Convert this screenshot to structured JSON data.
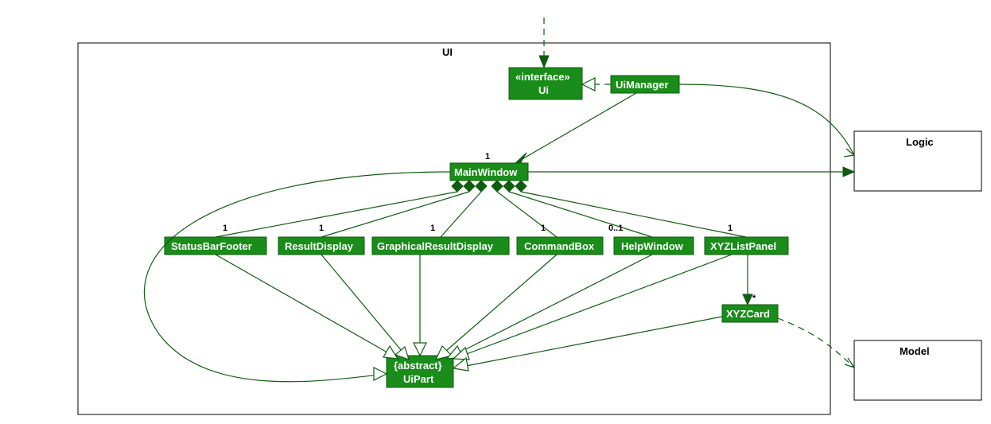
{
  "package": {
    "name": "UI"
  },
  "classes": {
    "ui": {
      "stereo": "«interface»",
      "name": "Ui"
    },
    "uimanager": {
      "name": "UiManager"
    },
    "mainwindow": {
      "name": "MainWindow"
    },
    "statusbarfooter": {
      "name": "StatusBarFooter"
    },
    "resultdisplay": {
      "name": "ResultDisplay"
    },
    "graphicalresultdisplay": {
      "name": "GraphicalResultDisplay"
    },
    "commandbox": {
      "name": "CommandBox"
    },
    "helpwindow": {
      "name": "HelpWindow"
    },
    "xyzlistpanel": {
      "name": "XYZListPanel"
    },
    "xyzcard": {
      "name": "XYZCard"
    },
    "uipart": {
      "stereo": "{abstract}",
      "name": "UiPart"
    }
  },
  "external": {
    "logic": {
      "name": "Logic"
    },
    "model": {
      "name": "Model"
    }
  },
  "mult": {
    "mainwindow": "1",
    "statusbarfooter": "1",
    "resultdisplay": "1",
    "graphicalresultdisplay": "1",
    "commandbox": "1",
    "helpwindow": "0..1",
    "xyzlistpanel": "1",
    "xyzcard": "*"
  },
  "chart_data": {
    "type": "uml_class_diagram",
    "package": "UI",
    "nodes": [
      {
        "id": "Ui",
        "stereo": "interface"
      },
      {
        "id": "UiManager"
      },
      {
        "id": "MainWindow"
      },
      {
        "id": "StatusBarFooter"
      },
      {
        "id": "ResultDisplay"
      },
      {
        "id": "GraphicalResultDisplay"
      },
      {
        "id": "CommandBox"
      },
      {
        "id": "HelpWindow"
      },
      {
        "id": "XYZListPanel"
      },
      {
        "id": "XYZCard"
      },
      {
        "id": "UiPart",
        "stereo": "abstract"
      },
      {
        "id": "Logic",
        "external": true
      },
      {
        "id": "Model",
        "external": true
      }
    ],
    "edges": [
      {
        "from": "outside",
        "to": "Ui",
        "type": "dependency"
      },
      {
        "from": "UiManager",
        "to": "Ui",
        "type": "realization"
      },
      {
        "from": "UiManager",
        "to": "MainWindow",
        "type": "association",
        "mult": "1"
      },
      {
        "from": "UiManager",
        "to": "Logic",
        "type": "association"
      },
      {
        "from": "MainWindow",
        "to": "Logic",
        "type": "association"
      },
      {
        "from": "MainWindow",
        "to": "StatusBarFooter",
        "type": "composition",
        "mult": "1"
      },
      {
        "from": "MainWindow",
        "to": "ResultDisplay",
        "type": "composition",
        "mult": "1"
      },
      {
        "from": "MainWindow",
        "to": "GraphicalResultDisplay",
        "type": "composition",
        "mult": "1"
      },
      {
        "from": "MainWindow",
        "to": "CommandBox",
        "type": "composition",
        "mult": "1"
      },
      {
        "from": "MainWindow",
        "to": "HelpWindow",
        "type": "composition",
        "mult": "0..1"
      },
      {
        "from": "MainWindow",
        "to": "XYZListPanel",
        "type": "composition",
        "mult": "1"
      },
      {
        "from": "XYZListPanel",
        "to": "XYZCard",
        "type": "association",
        "mult": "*"
      },
      {
        "from": "XYZCard",
        "to": "Model",
        "type": "dependency"
      },
      {
        "from": "MainWindow",
        "to": "UiPart",
        "type": "generalization"
      },
      {
        "from": "StatusBarFooter",
        "to": "UiPart",
        "type": "generalization"
      },
      {
        "from": "ResultDisplay",
        "to": "UiPart",
        "type": "generalization"
      },
      {
        "from": "GraphicalResultDisplay",
        "to": "UiPart",
        "type": "generalization"
      },
      {
        "from": "CommandBox",
        "to": "UiPart",
        "type": "generalization"
      },
      {
        "from": "HelpWindow",
        "to": "UiPart",
        "type": "generalization"
      },
      {
        "from": "XYZListPanel",
        "to": "UiPart",
        "type": "generalization"
      },
      {
        "from": "XYZCard",
        "to": "UiPart",
        "type": "generalization"
      }
    ]
  }
}
